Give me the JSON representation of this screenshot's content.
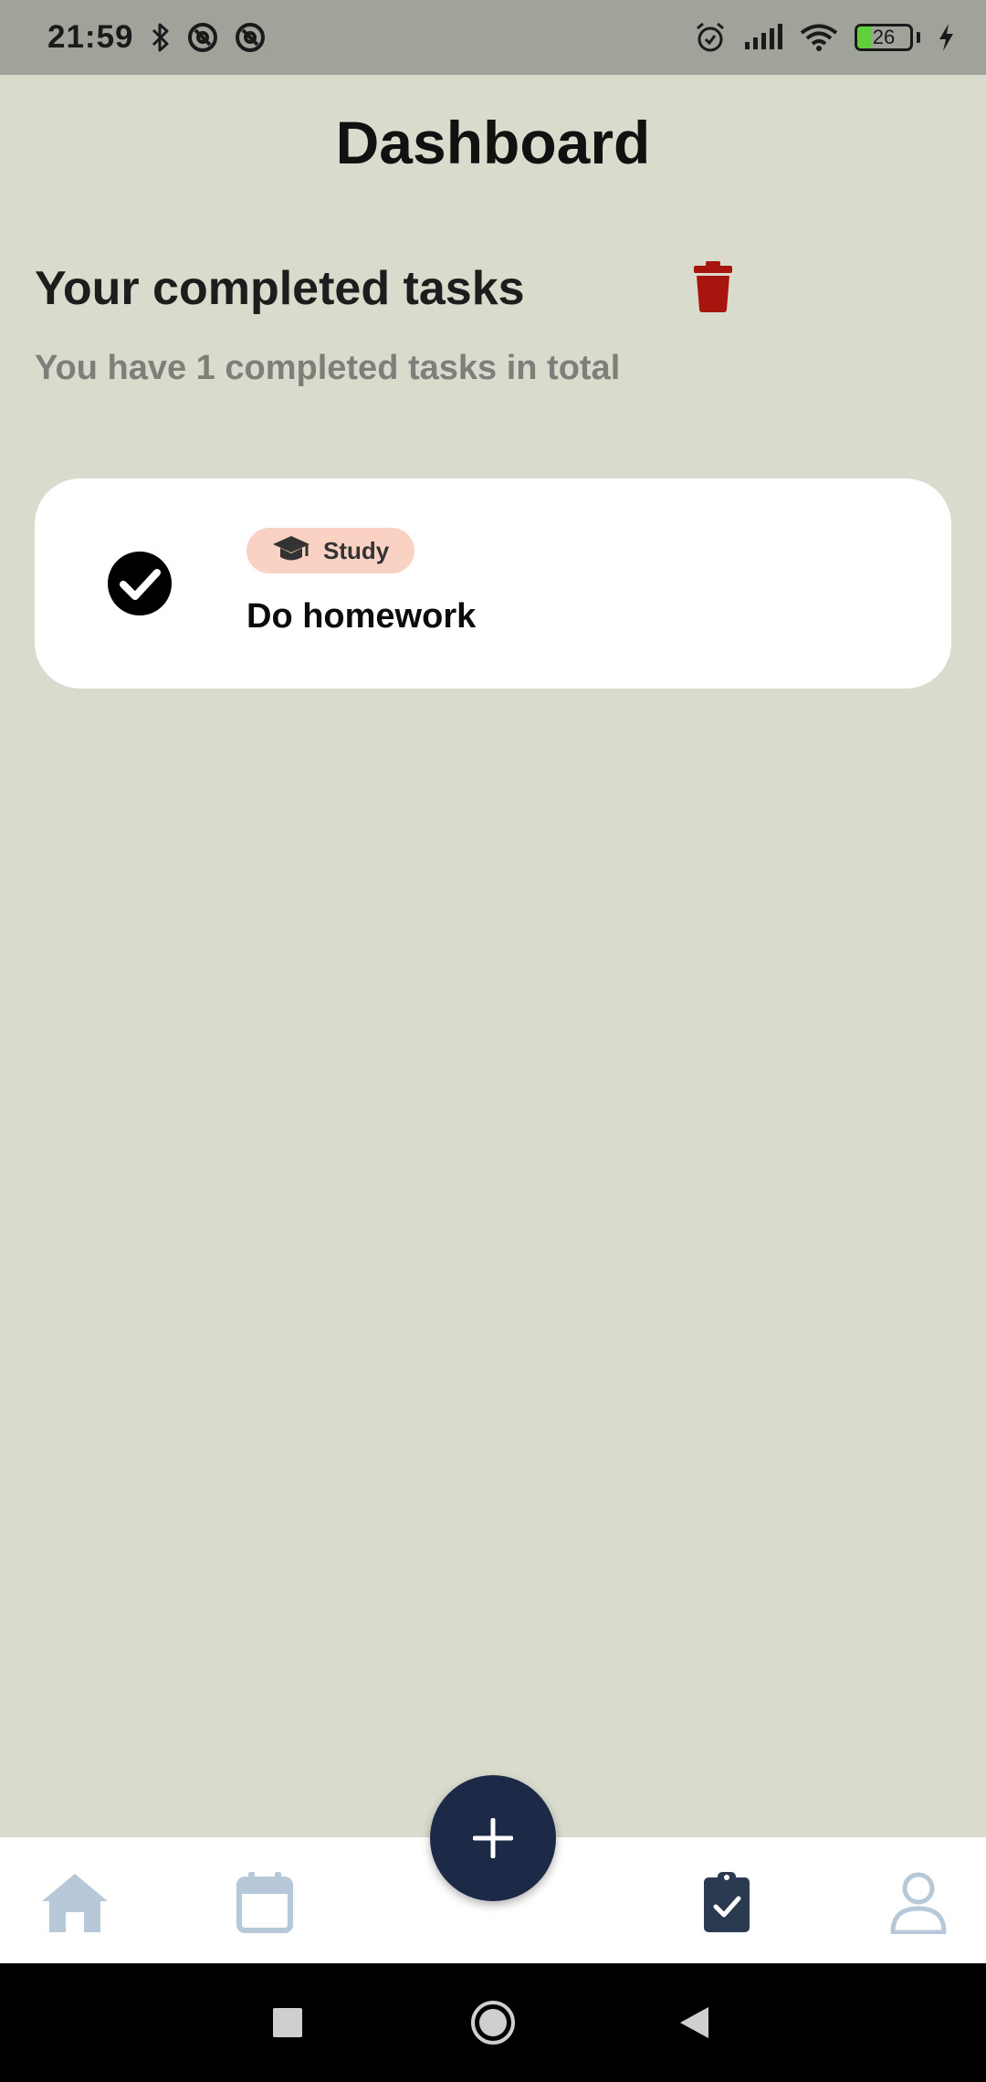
{
  "status_bar": {
    "time": "21:59",
    "battery_level": "26",
    "battery_fraction": 0.26,
    "icons": [
      "bluetooth-icon",
      "at-sign-icon",
      "at-sign-icon",
      "alarm-icon",
      "signal-icon",
      "wifi-icon",
      "battery-icon",
      "charging-icon"
    ]
  },
  "header": {
    "title": "Dashboard"
  },
  "section": {
    "title": "Your completed tasks",
    "subtitle": "You have 1 completed tasks in total",
    "delete_icon": "trash-icon"
  },
  "tasks": [
    {
      "category": "Study",
      "category_icon": "graduation-cap-icon",
      "name": "Do homework",
      "completed": true
    }
  ],
  "bottom_nav": {
    "items": [
      "home-icon",
      "calendar-icon",
      "add-icon",
      "clipboard-check-icon",
      "profile-icon"
    ],
    "active": "clipboard-check-icon"
  },
  "system_nav": {
    "items": [
      "recent-apps-icon",
      "home-circle-icon",
      "back-icon"
    ]
  },
  "colors": {
    "background": "#d9dccd",
    "status_bar": "#a0a39a",
    "trash": "#a8140e",
    "chip": "#f9d2c4",
    "fab": "#1c2a48",
    "nav_inactive": "#b7c9d8",
    "nav_active": "#2a3a50",
    "battery_fill": "#5fcf3a"
  }
}
